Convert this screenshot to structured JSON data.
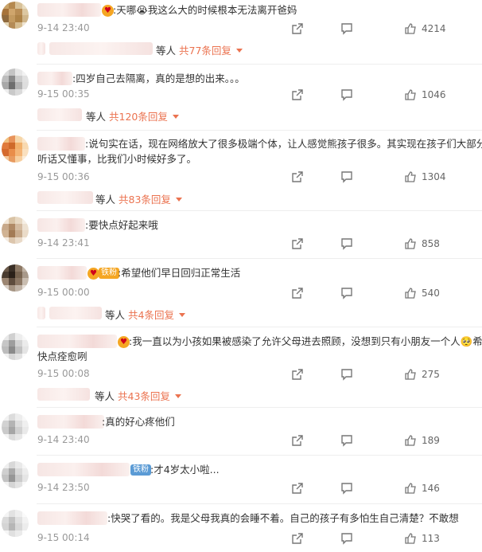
{
  "comments": [
    {
      "text": ":天哪😭我这么大的时候根本无法离开爸妈",
      "time": "9-14 23:40",
      "likes": "4214",
      "reply_suffix": "等人",
      "reply_count": "共77条回复"
    },
    {
      "text": ":四岁自己去隔离，真的是想的出来。。。",
      "time": "9-15 00:35",
      "likes": "1046",
      "reply_suffix": "等人",
      "reply_count": "共120条回复"
    },
    {
      "text_line1": ":说句实在话，现在网络放大了很多极端个体，让人感觉熊孩子很多。其实现在孩子们大部分都",
      "text_line2": "听话又懂事，比我们小时候好多了。",
      "time": "9-15 00:36",
      "likes": "1304",
      "reply_suffix": "等人",
      "reply_count": "共83条回复"
    },
    {
      "text": ":要快点好起来哦",
      "time": "9-14 23:41",
      "likes": "858"
    },
    {
      "text": ":希望他们早日回归正常生活",
      "time": "9-15 00:00",
      "likes": "540",
      "badge": "铁粉",
      "reply_suffix": "等人",
      "reply_count": "共4条回复"
    },
    {
      "text_line1": ":我一直以为小孩如果被感染了允许父母进去照顾，没想到只有小朋友一个人🥺希望",
      "text_line2": "快点痊愈咧",
      "time": "9-15 00:08",
      "likes": "275",
      "reply_suffix": "等人",
      "reply_count": "共43条回复"
    },
    {
      "text": ":真的好心疼他们",
      "time": "9-14 23:40",
      "likes": "189"
    },
    {
      "text": ":才4岁太小啦...",
      "time": "9-14 23:50",
      "likes": "146",
      "badge": "铁粉"
    },
    {
      "text": ":快哭了看的。我是父母我真的会睡不着。自己的孩子有多怕生自己清楚？不敢想",
      "time": "9-15 00:14",
      "likes": "113"
    }
  ],
  "icons": {
    "share": "share-icon",
    "comment": "comment-icon",
    "like": "thumbs-up-icon",
    "caret": "caret-down-icon"
  },
  "colors": {
    "accent": "#eb7350",
    "time": "#999999",
    "text": "#333333",
    "badge_orange": "#f5a623",
    "badge_blue": "#5b9bd5"
  }
}
